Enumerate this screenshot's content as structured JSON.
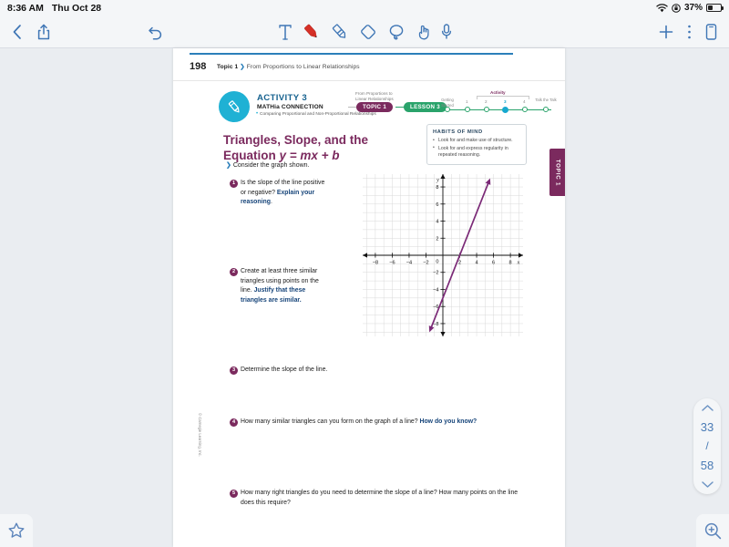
{
  "statusbar": {
    "time": "8:36 AM",
    "date": "Thu Oct 28",
    "battery_percent": "37%",
    "wifi_icon": "wifi-icon",
    "lock_icon": "rotation-lock-icon",
    "battery_icon": "battery-icon"
  },
  "toolbar": {
    "back_icon": "chevron-left-icon",
    "share_icon": "share-icon",
    "undo_icon": "undo-icon",
    "text_tool_icon": "text-tool-icon",
    "pen_tool_icon": "pen-tool-icon",
    "highlighter_tool_icon": "highlighter-tool-icon",
    "eraser_tool_icon": "eraser-tool-icon",
    "lasso_tool_icon": "lasso-tool-icon",
    "hand_tool_icon": "hand-tool-icon",
    "mic_icon": "microphone-icon",
    "add_icon": "plus-icon",
    "more_icon": "more-options-icon",
    "pages_icon": "page-view-icon",
    "pen_color": "#d63027",
    "tool_color": "#3f76b5"
  },
  "page": {
    "number": "198",
    "breadcrumb_topic": "Topic 1",
    "breadcrumb_chevron": "❯",
    "breadcrumb_title": "From Proportions to Linear Relationships",
    "rule_color": "#2b7fba"
  },
  "activity": {
    "icon": "pencil-icon",
    "title": "ACTIVITY 3",
    "subtitle": "MATHia CONNECTION",
    "detail": "Comparing Proportional and Non-Proportional Relationships",
    "circle_color": "#1fb1d4",
    "chip_caption": "From Proportions to Linear Relationships",
    "chip_topic": "TOPIC 1",
    "chip_lesson": "LESSON 3",
    "chip_topic_color": "#7b2a5e",
    "chip_lesson_color": "#2aa36b"
  },
  "progress": {
    "activity_label": "Activity",
    "start_label": "Getting Started",
    "end_label": "Talk the Talk",
    "steps": [
      "1",
      "2",
      "3",
      "4"
    ],
    "active_step": "3",
    "active_color": "#16a8cf"
  },
  "lesson": {
    "title_line1": "Triangles, Slope, and the",
    "title_line2_pre": "Equation ",
    "title_line2_italic": "y = mx + b",
    "title_color": "#7b2a5e",
    "consider": "Consider the graph shown.",
    "topic_tab": "TOPIC 1"
  },
  "habits": {
    "heading": "HABITS OF MIND",
    "items": [
      "Look for and make use of structure.",
      "Look for and express regularity in repeated reasoning."
    ]
  },
  "questions": [
    {
      "num": "1",
      "parts": [
        {
          "text": "Is the slope of the line positive or negative? ",
          "bold": false
        },
        {
          "text": "Explain your reasoning",
          "bold": true
        },
        {
          "text": ".",
          "bold": false
        }
      ]
    },
    {
      "num": "2",
      "parts": [
        {
          "text": "Create at least three similar triangles using points on the line. ",
          "bold": false
        },
        {
          "text": "Justify that these triangles are similar.",
          "bold": true
        }
      ]
    },
    {
      "num": "3",
      "parts": [
        {
          "text": "Determine the slope of the line.",
          "bold": false
        }
      ]
    },
    {
      "num": "4",
      "parts": [
        {
          "text": "How many similar triangles can you form on the graph of a line? ",
          "bold": false
        },
        {
          "text": "How do you know?",
          "bold": true
        }
      ]
    },
    {
      "num": "5",
      "parts": [
        {
          "text": "How many right triangles do you need to determine the slope of a line? How many points on the line does this require?",
          "bold": false
        }
      ]
    }
  ],
  "copyright": "© Carnegie Learning, Inc.",
  "navigation": {
    "up_icon": "chevron-up-icon",
    "down_icon": "chevron-down-icon",
    "current_page": "33",
    "separator": "/",
    "total_pages": "58",
    "bookmark_icon": "star-icon",
    "zoom_icon": "zoom-in-icon"
  },
  "chart_data": {
    "type": "line",
    "title": "",
    "xlabel": "x",
    "ylabel": "y",
    "xlim": [
      -9.5,
      9.5
    ],
    "ylim": [
      -9.5,
      9.5
    ],
    "xticks": [
      -8,
      -6,
      -4,
      -2,
      2,
      4,
      6,
      8
    ],
    "yticks": [
      -8,
      -6,
      -4,
      -2,
      2,
      4,
      6,
      8
    ],
    "grid": true,
    "grid_step": 1,
    "line_color": "#7b2a77",
    "series": [
      {
        "name": "line",
        "slope": 2.5,
        "intercept": -5,
        "equation": "y = 2.5x - 5",
        "endpoints": [
          [
            -1.6,
            -9
          ],
          [
            5.6,
            9
          ]
        ],
        "arrows": "both"
      }
    ]
  }
}
